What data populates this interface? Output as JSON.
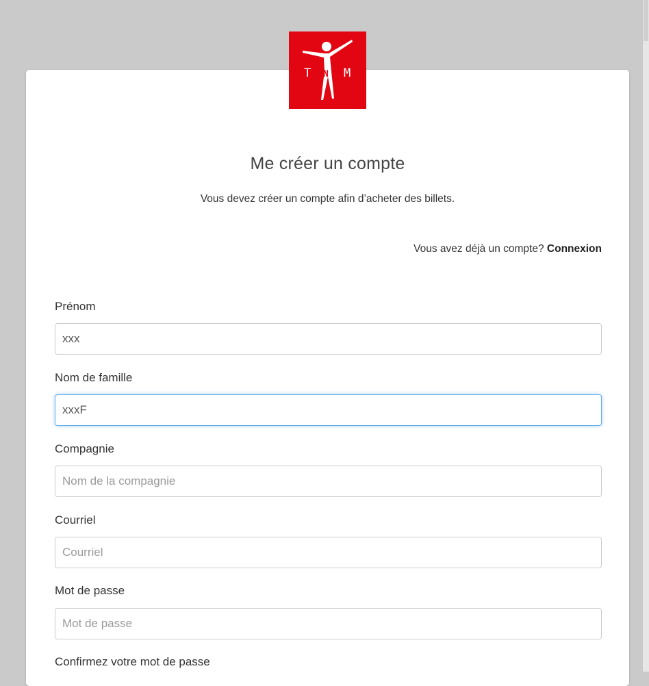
{
  "brand": {
    "logo_text_left": "T",
    "logo_text_mid": "N",
    "logo_text_right": "M",
    "logo_color": "#e20613"
  },
  "form": {
    "title": "Me créer un compte",
    "subtitle": "Vous devez créer un compte afin d’acheter des billets.",
    "login_prompt": "Vous avez déjà un compte? ",
    "login_link": "Connexion",
    "fields": [
      {
        "label": "Prénom",
        "value": "xxx",
        "placeholder": ""
      },
      {
        "label": "Nom de famille",
        "value": "xxxF",
        "placeholder": ""
      },
      {
        "label": "Compagnie",
        "value": "",
        "placeholder": "Nom de la compagnie"
      },
      {
        "label": "Courriel",
        "value": "",
        "placeholder": "Courriel"
      },
      {
        "label": "Mot de passe",
        "value": "",
        "placeholder": "Mot de passe"
      },
      {
        "label": "Confirmez votre mot de passe",
        "value": "",
        "placeholder": ""
      }
    ]
  },
  "colors": {
    "background": "#c9cac9",
    "card": "#ffffff",
    "focus": "#66afe9"
  }
}
